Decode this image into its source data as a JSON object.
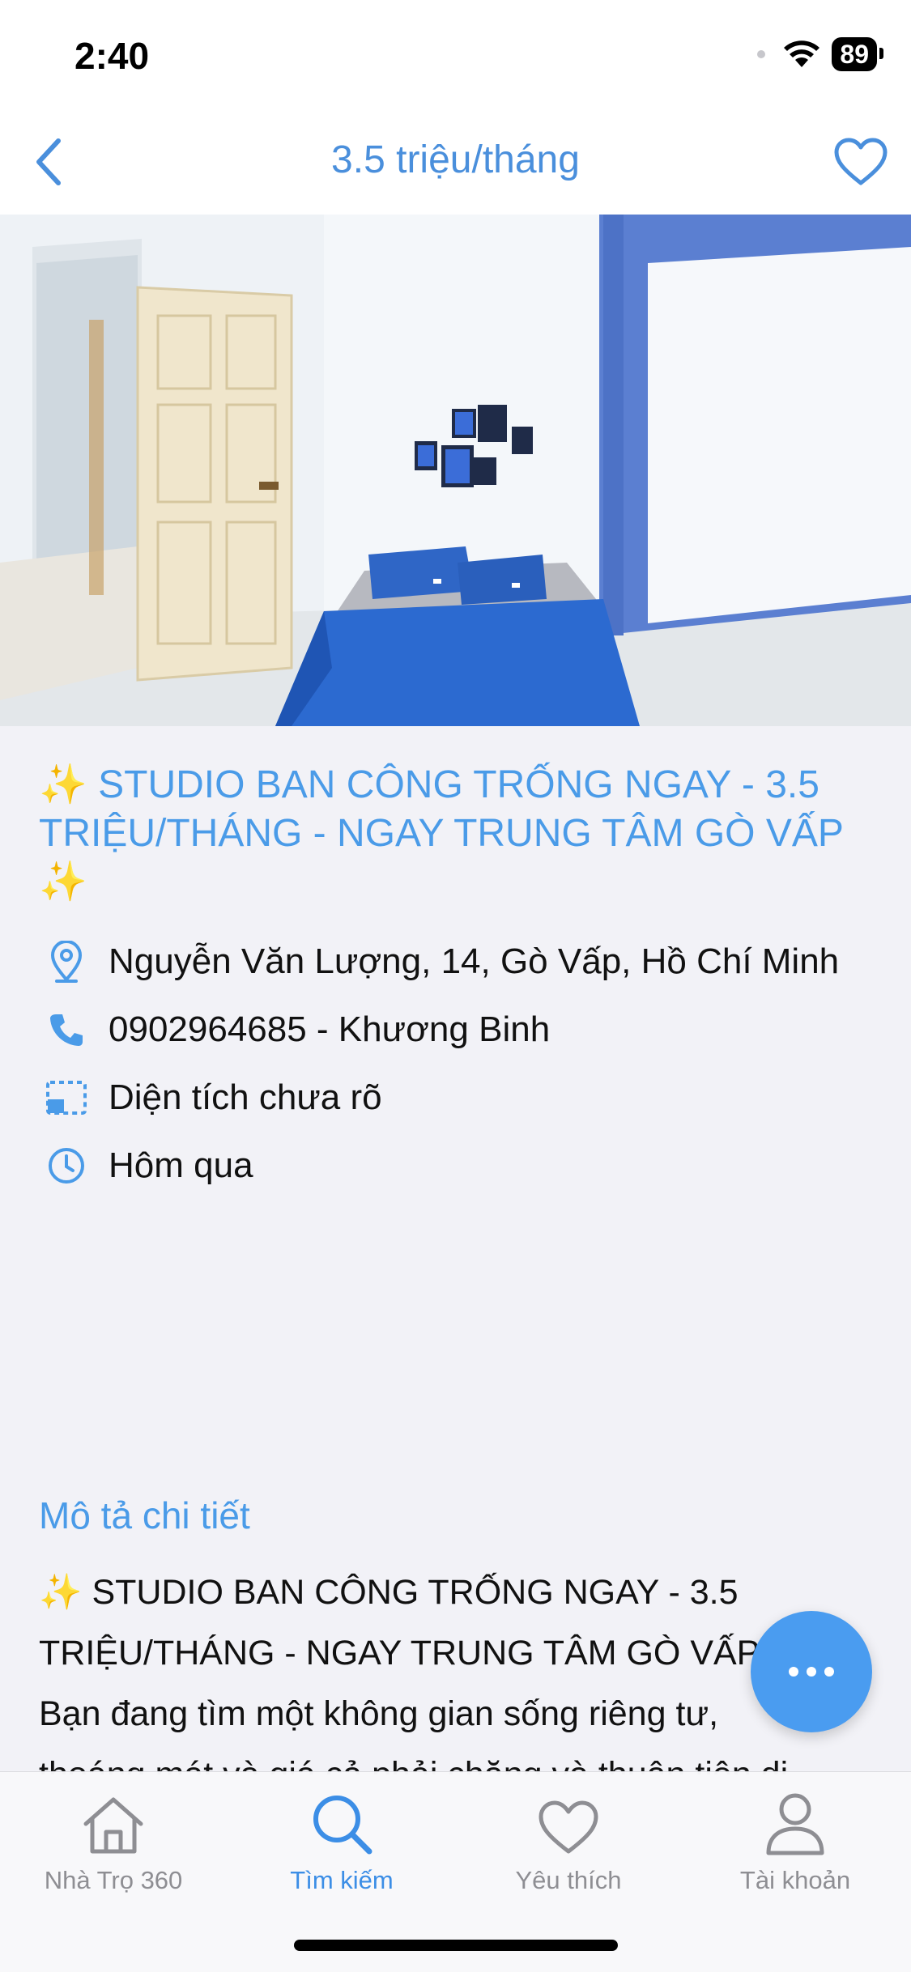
{
  "status": {
    "time": "2:40",
    "battery": "89"
  },
  "nav": {
    "title": "3.5 triệu/tháng",
    "back_icon": "chevron-left-icon",
    "favorite_icon": "heart-icon"
  },
  "listing": {
    "title": "✨ STUDIO BAN CÔNG TRỐNG NGAY - 3.5 TRIỆU/THÁNG - NGAY TRUNG TÂM GÒ VẤP ✨",
    "address": "Nguyễn Văn Lượng, 14, Gò Vấp, Hồ Chí Minh",
    "phone": "0902964685 - Khương Binh",
    "area": "Diện tích chưa rõ",
    "posted": "Hôm qua"
  },
  "description": {
    "heading": "Mô tả chi tiết",
    "line1": "✨ STUDIO BAN CÔNG TRỐNG NGAY - 3.5",
    "line2": "TRIỆU/THÁNG - NGAY TRUNG TÂM GÒ VẤP",
    "line3": "Bạn đang tìm một không gian sống riêng tư,",
    "line4": "thoáng mát và giá cả phải chăng và thuận tiện di"
  },
  "tabs": [
    {
      "label": "Nhà Trọ 360",
      "icon": "home-icon",
      "active": false
    },
    {
      "label": "Tìm kiếm",
      "icon": "search-icon",
      "active": true
    },
    {
      "label": "Yêu thích",
      "icon": "heart-icon",
      "active": false
    },
    {
      "label": "Tài khoản",
      "icon": "user-icon",
      "active": false
    }
  ],
  "colors": {
    "accent": "#4a9be8",
    "active_tab": "#3c8ee6",
    "inactive_tab": "#8e8e93",
    "fab": "#4a9cf0"
  }
}
